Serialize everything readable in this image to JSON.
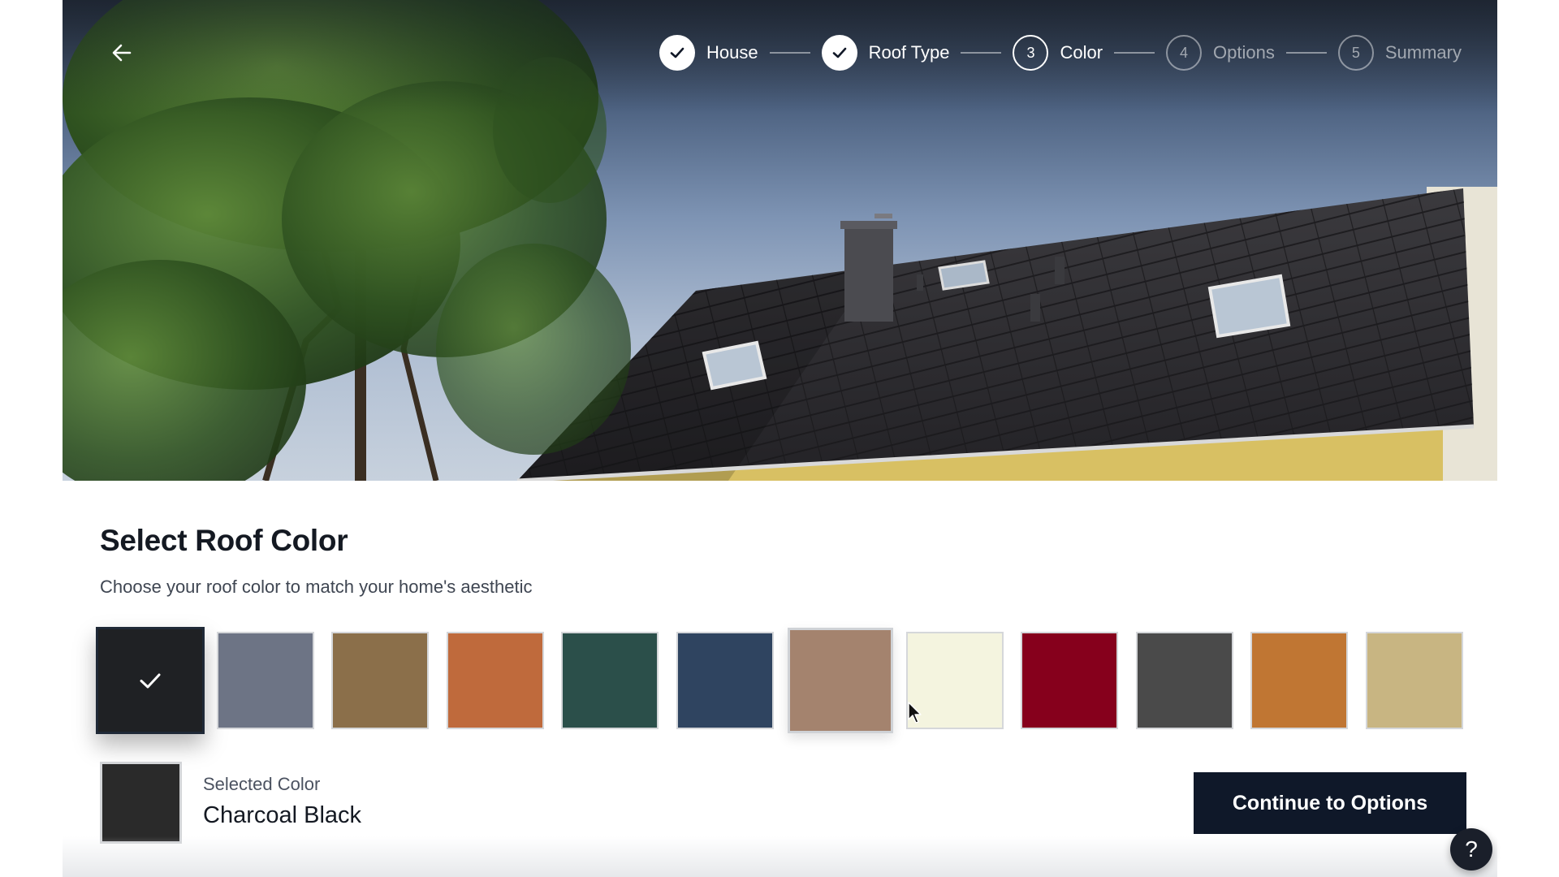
{
  "nav": {
    "back_icon": "arrow-left-icon",
    "steps": [
      {
        "label": "House",
        "number": "1",
        "state": "done"
      },
      {
        "label": "Roof Type",
        "number": "2",
        "state": "done"
      },
      {
        "label": "Color",
        "number": "3",
        "state": "current"
      },
      {
        "label": "Options",
        "number": "4",
        "state": "upcoming"
      },
      {
        "label": "Summary",
        "number": "5",
        "state": "upcoming"
      }
    ]
  },
  "main": {
    "title": "Select Roof Color",
    "subtitle": "Choose your roof color to match your home's aesthetic",
    "swatches": [
      {
        "color": "#1f2124",
        "selected": true
      },
      {
        "color": "#6d7485"
      },
      {
        "color": "#8b6f4a"
      },
      {
        "color": "#bf6a3c"
      },
      {
        "color": "#2b4f4a"
      },
      {
        "color": "#2f4460"
      },
      {
        "color": "#a4836e",
        "hovered": true
      },
      {
        "color": "#f4f4df"
      },
      {
        "color": "#86001c"
      },
      {
        "color": "#4a4a4a"
      },
      {
        "color": "#c07633"
      },
      {
        "color": "#c8b582"
      }
    ],
    "selected_caption": "Selected Color",
    "selected_name": "Charcoal Black",
    "selected_color": "#2a2a2a",
    "continue_label": "Continue to Options"
  },
  "help": {
    "label": "?",
    "icon": "help-icon"
  }
}
